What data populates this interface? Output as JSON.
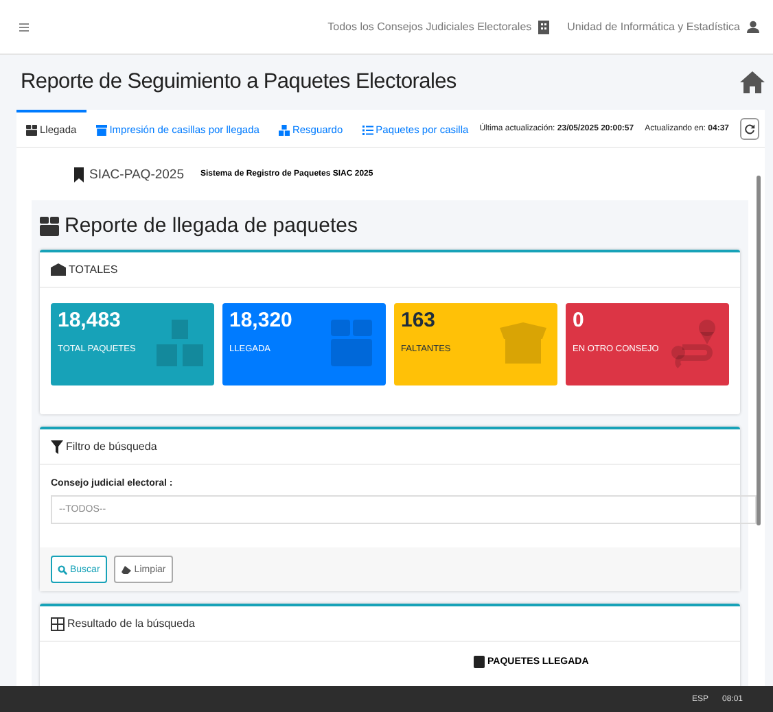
{
  "topbar": {
    "council": "Todos los Consejos Judiciales Electorales",
    "unit": "Unidad de Informática y Estadística"
  },
  "page_title": "Reporte de Seguimiento a Paquetes Electorales",
  "tabs": [
    {
      "label": "Llegada",
      "selected": true
    },
    {
      "label": "Impresión de casillas por llegada",
      "selected": false
    },
    {
      "label": "Resguardo",
      "selected": false
    },
    {
      "label": "Paquetes por casilla",
      "selected": false
    }
  ],
  "update": {
    "label": "Última actualización:",
    "value": "23/05/2025 20:00:57",
    "countdown_label": "Actualizando en:",
    "countdown": "04:37"
  },
  "system": {
    "code": "SIAC-PAQ-2025",
    "name": "Sistema de Registro de Paquetes SIAC 2025"
  },
  "report_title": "Reporte de llegada de paquetes",
  "totals": {
    "title": "TOTALES",
    "boxes": [
      {
        "value": "18,483",
        "label": "TOTAL PAQUETES",
        "color": "#17a2b8"
      },
      {
        "value": "18,320",
        "label": "LLEGADA",
        "color": "#007bff"
      },
      {
        "value": "163",
        "label": "FALTANTES",
        "color": "#ffc107"
      },
      {
        "value": "0",
        "label": "EN OTRO CONSEJO",
        "color": "#dc3545"
      }
    ]
  },
  "filter": {
    "title": "Filtro de búsqueda",
    "field_label": "Consejo judicial electoral :",
    "select_value": "--TODOS--",
    "buttons": [
      "Buscar",
      "Limpiar"
    ]
  },
  "results": {
    "title": "Resultado de la búsqueda",
    "column_header": "PAQUETES LLEGADA"
  },
  "taskbar": {
    "language": "ESP",
    "time": "08:01"
  }
}
